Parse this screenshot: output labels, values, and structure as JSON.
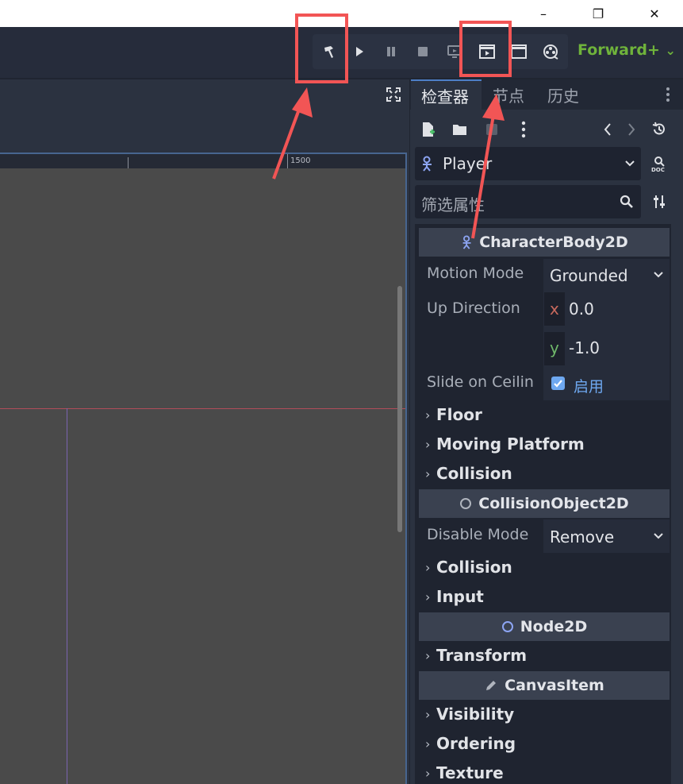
{
  "window": {
    "minimize_glyph": "–",
    "restore_glyph": "❐",
    "close_glyph": "✕"
  },
  "toolbar": {
    "renderer_label": "Forward+",
    "renderer_chevron": "⌄",
    "icons": [
      "build-hammer-icon",
      "play-icon",
      "pause-icon",
      "stop-icon",
      "remote-debug-icon",
      "play-scene-icon",
      "play-custom-scene-icon",
      "movie-maker-icon"
    ]
  },
  "viewport": {
    "ruler_label": "1500"
  },
  "inspector": {
    "tabs": [
      "检查器",
      "节点",
      "历史"
    ],
    "object_name": "Player",
    "filter_placeholder": "筛选属性",
    "sections": {
      "characterbody": "CharacterBody2D",
      "collisionobject": "CollisionObject2D",
      "node2d": "Node2D",
      "canvasitem": "CanvasItem"
    },
    "props": {
      "motion_mode_label": "Motion Mode",
      "motion_mode_value": "Grounded",
      "up_direction_label": "Up Direction",
      "up_x_label": "x",
      "up_x_value": "0.0",
      "up_y_label": "y",
      "up_y_value": "-1.0",
      "slide_label": "Slide on Ceilin",
      "slide_value": "启用",
      "disable_mode_label": "Disable Mode",
      "disable_mode_value": "Remove"
    },
    "groups": {
      "floor": "Floor",
      "moving_platform": "Moving Platform",
      "collision1": "Collision",
      "collision2": "Collision",
      "input": "Input",
      "transform": "Transform",
      "visibility": "Visibility",
      "ordering": "Ordering",
      "texture": "Texture"
    }
  },
  "colors": {
    "accent_green": "#6fb33b",
    "annotation_red": "#f25555",
    "checkbox_blue": "#6ea8f0"
  }
}
